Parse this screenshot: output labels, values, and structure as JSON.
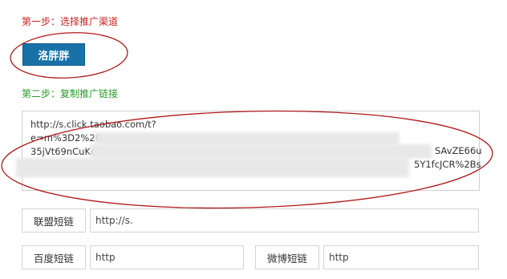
{
  "step1": {
    "title": "第一步：选择推广渠道",
    "channel_button": "洛胖胖"
  },
  "step2": {
    "title": "第二步：复制推广链接",
    "link_lines": [
      "http://s.click.taobao.com/t?",
      "e=m%3D2%26",
      "35jVt69nCuKc",
      "SAvZE66u",
      "5Y1fcJCR%2Bs"
    ]
  },
  "short_links": {
    "union_label": "联盟短链",
    "union_value": "http://s.",
    "baidu_label": "百度短链",
    "baidu_value": "http",
    "weibo_label": "微博短链",
    "weibo_value": "http"
  },
  "colors": {
    "step1": "#cc2222",
    "step2": "#2a9a2a",
    "button": "#1872a8",
    "annotation": "#b01818"
  }
}
